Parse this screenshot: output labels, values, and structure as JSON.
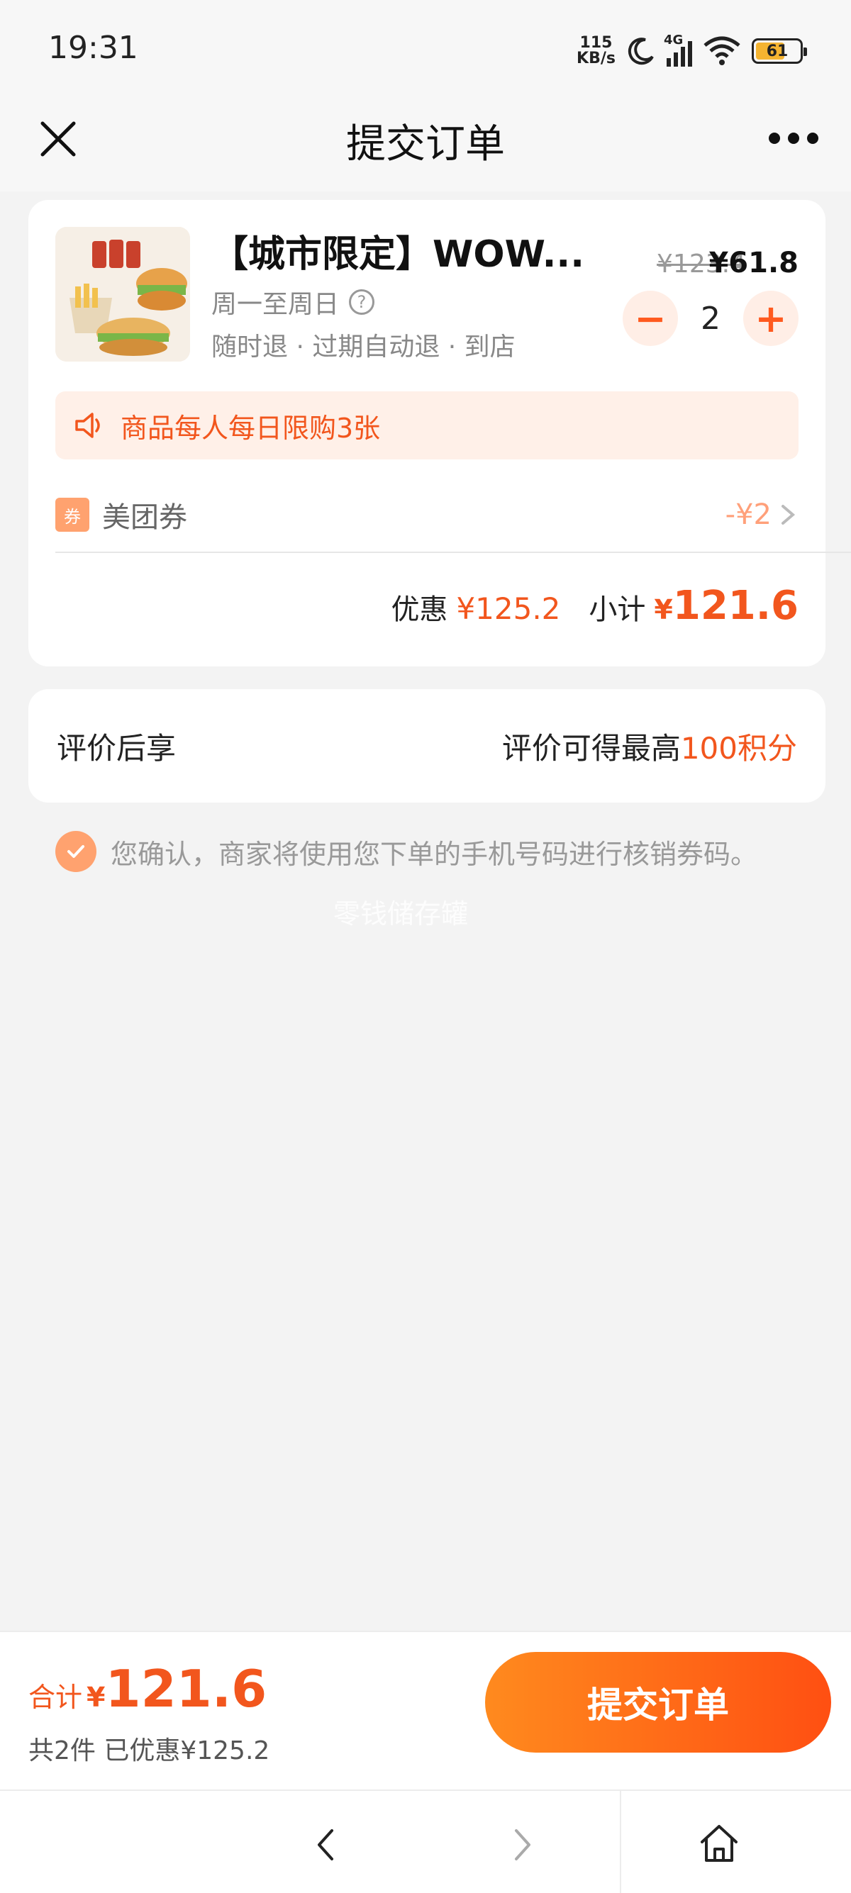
{
  "status_bar": {
    "time": "19:31",
    "net_speed_top": "115",
    "net_speed_bottom": "KB/s",
    "network": "4G",
    "battery": "61"
  },
  "nav": {
    "title": "提交订单"
  },
  "product": {
    "name": "【城市限定】WOW...",
    "days": "周一至周日",
    "tags": "随时退 · 过期自动退 · 到店",
    "original_price": "¥123.4",
    "price": "¥61.8",
    "quantity": "2",
    "minus_label": "−",
    "plus_label": "+",
    "help_glyph": "?"
  },
  "limit_banner": {
    "text": "商品每人每日限购3张"
  },
  "coupon": {
    "badge": "券",
    "label": "美团券",
    "value": "-¥2"
  },
  "summary": {
    "discount_label": "优惠",
    "discount_amount": "¥125.2",
    "subtotal_label": "小计",
    "subtotal_symbol": "¥",
    "subtotal_amount": "121.6"
  },
  "review": {
    "label": "评价后享",
    "reward_prefix": "评价可得最高",
    "reward_highlight": "100积分"
  },
  "consent": {
    "text": "您确认，商家将使用您下单的手机号码进行核销券码。",
    "checked": true
  },
  "watermark": "零钱储存罐",
  "bottom": {
    "total_label": "合计",
    "total_symbol": "¥",
    "total_amount": "121.6",
    "total_sub": "共2件  已优惠¥125.2",
    "submit_label": "提交订单"
  },
  "colors": {
    "accent": "#f2561d",
    "accent_light": "#ffa26f",
    "banner_bg": "#fff0e8",
    "background": "#f3f3f3"
  },
  "icons": {
    "close": "close-icon",
    "more": "more-icon",
    "speaker": "speaker-icon",
    "check": "check-icon",
    "back": "chevron-left-icon",
    "forward": "chevron-right-icon",
    "home": "home-icon"
  }
}
